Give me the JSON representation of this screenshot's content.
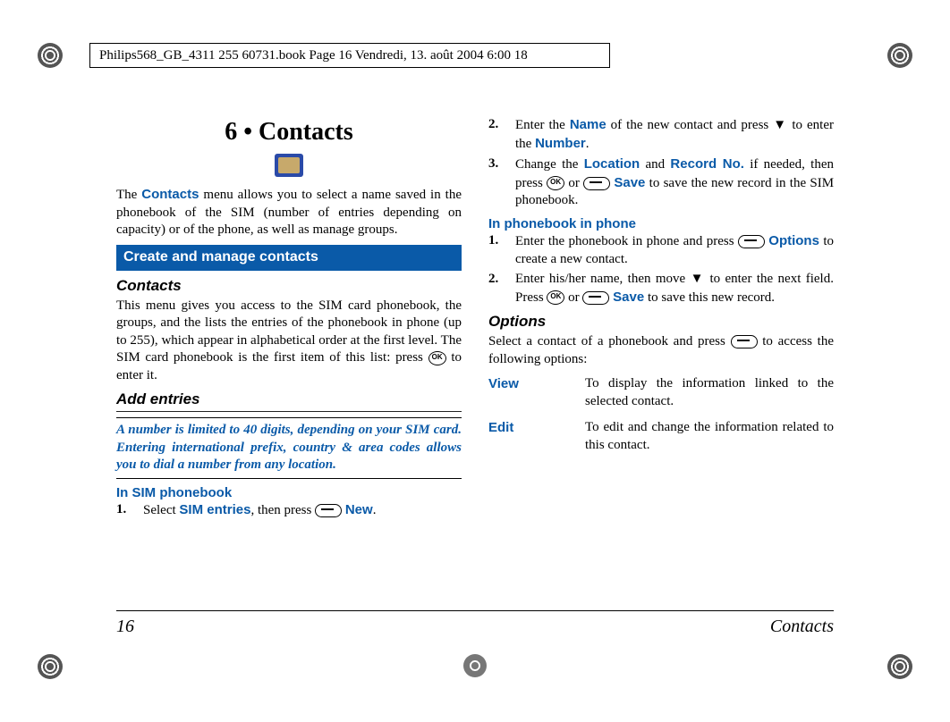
{
  "header_meta": "Philips568_GB_4311 255 60731.book  Page 16  Vendredi, 13. août 2004  6:00 18",
  "chapter_title": "6 • Contacts",
  "intro_text_a": "The ",
  "intro_term": "Contacts",
  "intro_text_b": " menu allows you to select a name saved in the phonebook of the SIM (number of entries depending on capacity) or of the phone, as well as manage groups.",
  "section_bar": "Create and manage contacts",
  "contacts_sub": "Contacts",
  "contacts_body_a": "This menu gives you access to the SIM card phonebook, the groups, and the lists the entries of the phonebook in phone (up to 255), which appear in alphabetical order at the first level. The SIM card phonebook is the first item of this list: press ",
  "contacts_body_b": " to enter it.",
  "add_sub": "Add entries",
  "callout": "A number is limited to 40 digits, depending on your SIM card. Entering international prefix, country & area codes allows you to dial a number from any location.",
  "sim_head": "In SIM phonebook",
  "sim_step1_a": "Select ",
  "sim_step1_term": "SIM entries",
  "sim_step1_b": ", then press ",
  "new_label": "New",
  "sim_step1_c": ".",
  "sim_step2_a": "Enter the ",
  "name_term": "Name",
  "sim_step2_b": " of the new contact and press ",
  "sim_step2_c": " to enter the ",
  "number_term": "Number",
  "sim_step2_d": ".",
  "sim_step3_a": "Change the ",
  "location_term": "Location",
  "sim_step3_b": " and ",
  "record_term": "Record No.",
  "sim_step3_c": " if needed, then press ",
  "sim_step3_d": " or ",
  "save_label": "Save",
  "sim_step3_e": " to save the new record in the SIM phonebook.",
  "phone_head": "In phonebook in phone",
  "phone_step1_a": "Enter the phonebook in phone and press ",
  "options_term": "Options",
  "phone_step1_b": " to create a new contact.",
  "phone_step2_a": "Enter his/her name, then move ",
  "phone_step2_b": " to enter the next field. Press ",
  "phone_step2_c": " or ",
  "phone_step2_d": " to save this new record.",
  "options_sub": "Options",
  "options_body_a": "Select a contact of a phonebook and press ",
  "options_body_b": " to access the following options:",
  "options": [
    {
      "label": "View",
      "desc": "To display the information linked to the selected contact."
    },
    {
      "label": "Edit",
      "desc": "To edit and change the information related to this contact."
    }
  ],
  "page_number": "16",
  "footer_section": "Contacts"
}
